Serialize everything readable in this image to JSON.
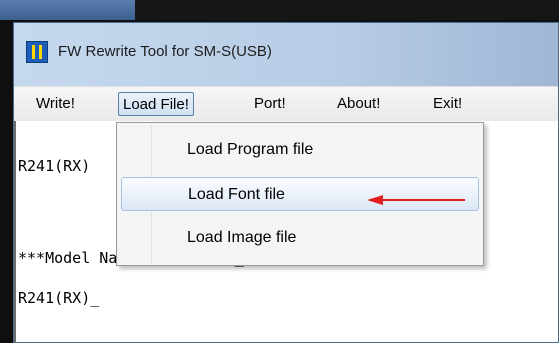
{
  "window": {
    "title": "FW Rewrite Tool for SM-S(USB)"
  },
  "menu": {
    "items": [
      {
        "label": "Write!"
      },
      {
        "label": "Load File!"
      },
      {
        "label": "Port!"
      },
      {
        "label": "About!"
      },
      {
        "label": "Exit!"
      }
    ],
    "active_index": 1
  },
  "dropdown": {
    "items": [
      {
        "label": "Load Program file"
      },
      {
        "label": "Load Font file"
      },
      {
        "label": "Load Image file"
      }
    ],
    "hover_index": 1
  },
  "console": {
    "lines": [
      "R241(RX)",
      "***Model Name = R241(RX)_",
      "R241(RX)_"
    ]
  },
  "annotation": {
    "arrow_color": "#e21e1e"
  },
  "colors": {
    "titlebar": "#c5d8ee",
    "menubar": "#f0f0f0",
    "menu_active_border": "#5e7fa6",
    "dropdown_bg": "#f4f4f4"
  }
}
